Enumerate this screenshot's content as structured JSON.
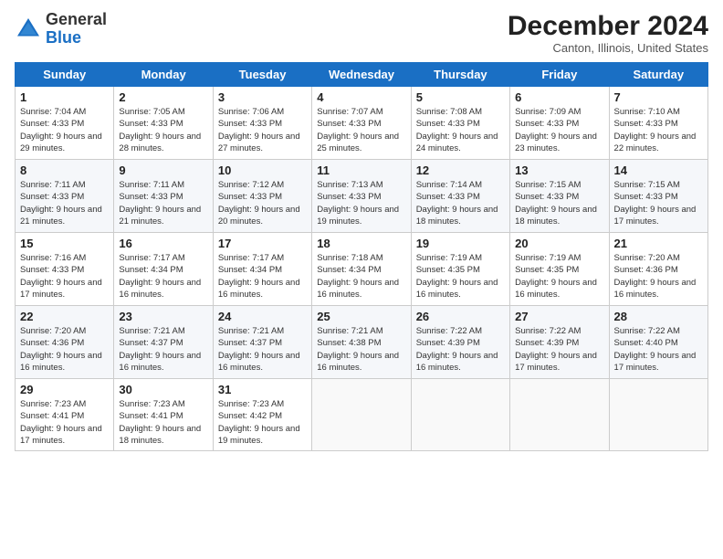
{
  "header": {
    "logo_general": "General",
    "logo_blue": "Blue",
    "month_year": "December 2024",
    "location": "Canton, Illinois, United States"
  },
  "weekdays": [
    "Sunday",
    "Monday",
    "Tuesday",
    "Wednesday",
    "Thursday",
    "Friday",
    "Saturday"
  ],
  "weeks": [
    [
      {
        "day": "1",
        "sunrise": "Sunrise: 7:04 AM",
        "sunset": "Sunset: 4:33 PM",
        "daylight": "Daylight: 9 hours and 29 minutes."
      },
      {
        "day": "2",
        "sunrise": "Sunrise: 7:05 AM",
        "sunset": "Sunset: 4:33 PM",
        "daylight": "Daylight: 9 hours and 28 minutes."
      },
      {
        "day": "3",
        "sunrise": "Sunrise: 7:06 AM",
        "sunset": "Sunset: 4:33 PM",
        "daylight": "Daylight: 9 hours and 27 minutes."
      },
      {
        "day": "4",
        "sunrise": "Sunrise: 7:07 AM",
        "sunset": "Sunset: 4:33 PM",
        "daylight": "Daylight: 9 hours and 25 minutes."
      },
      {
        "day": "5",
        "sunrise": "Sunrise: 7:08 AM",
        "sunset": "Sunset: 4:33 PM",
        "daylight": "Daylight: 9 hours and 24 minutes."
      },
      {
        "day": "6",
        "sunrise": "Sunrise: 7:09 AM",
        "sunset": "Sunset: 4:33 PM",
        "daylight": "Daylight: 9 hours and 23 minutes."
      },
      {
        "day": "7",
        "sunrise": "Sunrise: 7:10 AM",
        "sunset": "Sunset: 4:33 PM",
        "daylight": "Daylight: 9 hours and 22 minutes."
      }
    ],
    [
      {
        "day": "8",
        "sunrise": "Sunrise: 7:11 AM",
        "sunset": "Sunset: 4:33 PM",
        "daylight": "Daylight: 9 hours and 21 minutes."
      },
      {
        "day": "9",
        "sunrise": "Sunrise: 7:11 AM",
        "sunset": "Sunset: 4:33 PM",
        "daylight": "Daylight: 9 hours and 21 minutes."
      },
      {
        "day": "10",
        "sunrise": "Sunrise: 7:12 AM",
        "sunset": "Sunset: 4:33 PM",
        "daylight": "Daylight: 9 hours and 20 minutes."
      },
      {
        "day": "11",
        "sunrise": "Sunrise: 7:13 AM",
        "sunset": "Sunset: 4:33 PM",
        "daylight": "Daylight: 9 hours and 19 minutes."
      },
      {
        "day": "12",
        "sunrise": "Sunrise: 7:14 AM",
        "sunset": "Sunset: 4:33 PM",
        "daylight": "Daylight: 9 hours and 18 minutes."
      },
      {
        "day": "13",
        "sunrise": "Sunrise: 7:15 AM",
        "sunset": "Sunset: 4:33 PM",
        "daylight": "Daylight: 9 hours and 18 minutes."
      },
      {
        "day": "14",
        "sunrise": "Sunrise: 7:15 AM",
        "sunset": "Sunset: 4:33 PM",
        "daylight": "Daylight: 9 hours and 17 minutes."
      }
    ],
    [
      {
        "day": "15",
        "sunrise": "Sunrise: 7:16 AM",
        "sunset": "Sunset: 4:33 PM",
        "daylight": "Daylight: 9 hours and 17 minutes."
      },
      {
        "day": "16",
        "sunrise": "Sunrise: 7:17 AM",
        "sunset": "Sunset: 4:34 PM",
        "daylight": "Daylight: 9 hours and 16 minutes."
      },
      {
        "day": "17",
        "sunrise": "Sunrise: 7:17 AM",
        "sunset": "Sunset: 4:34 PM",
        "daylight": "Daylight: 9 hours and 16 minutes."
      },
      {
        "day": "18",
        "sunrise": "Sunrise: 7:18 AM",
        "sunset": "Sunset: 4:34 PM",
        "daylight": "Daylight: 9 hours and 16 minutes."
      },
      {
        "day": "19",
        "sunrise": "Sunrise: 7:19 AM",
        "sunset": "Sunset: 4:35 PM",
        "daylight": "Daylight: 9 hours and 16 minutes."
      },
      {
        "day": "20",
        "sunrise": "Sunrise: 7:19 AM",
        "sunset": "Sunset: 4:35 PM",
        "daylight": "Daylight: 9 hours and 16 minutes."
      },
      {
        "day": "21",
        "sunrise": "Sunrise: 7:20 AM",
        "sunset": "Sunset: 4:36 PM",
        "daylight": "Daylight: 9 hours and 16 minutes."
      }
    ],
    [
      {
        "day": "22",
        "sunrise": "Sunrise: 7:20 AM",
        "sunset": "Sunset: 4:36 PM",
        "daylight": "Daylight: 9 hours and 16 minutes."
      },
      {
        "day": "23",
        "sunrise": "Sunrise: 7:21 AM",
        "sunset": "Sunset: 4:37 PM",
        "daylight": "Daylight: 9 hours and 16 minutes."
      },
      {
        "day": "24",
        "sunrise": "Sunrise: 7:21 AM",
        "sunset": "Sunset: 4:37 PM",
        "daylight": "Daylight: 9 hours and 16 minutes."
      },
      {
        "day": "25",
        "sunrise": "Sunrise: 7:21 AM",
        "sunset": "Sunset: 4:38 PM",
        "daylight": "Daylight: 9 hours and 16 minutes."
      },
      {
        "day": "26",
        "sunrise": "Sunrise: 7:22 AM",
        "sunset": "Sunset: 4:39 PM",
        "daylight": "Daylight: 9 hours and 16 minutes."
      },
      {
        "day": "27",
        "sunrise": "Sunrise: 7:22 AM",
        "sunset": "Sunset: 4:39 PM",
        "daylight": "Daylight: 9 hours and 17 minutes."
      },
      {
        "day": "28",
        "sunrise": "Sunrise: 7:22 AM",
        "sunset": "Sunset: 4:40 PM",
        "daylight": "Daylight: 9 hours and 17 minutes."
      }
    ],
    [
      {
        "day": "29",
        "sunrise": "Sunrise: 7:23 AM",
        "sunset": "Sunset: 4:41 PM",
        "daylight": "Daylight: 9 hours and 17 minutes."
      },
      {
        "day": "30",
        "sunrise": "Sunrise: 7:23 AM",
        "sunset": "Sunset: 4:41 PM",
        "daylight": "Daylight: 9 hours and 18 minutes."
      },
      {
        "day": "31",
        "sunrise": "Sunrise: 7:23 AM",
        "sunset": "Sunset: 4:42 PM",
        "daylight": "Daylight: 9 hours and 19 minutes."
      },
      null,
      null,
      null,
      null
    ]
  ]
}
